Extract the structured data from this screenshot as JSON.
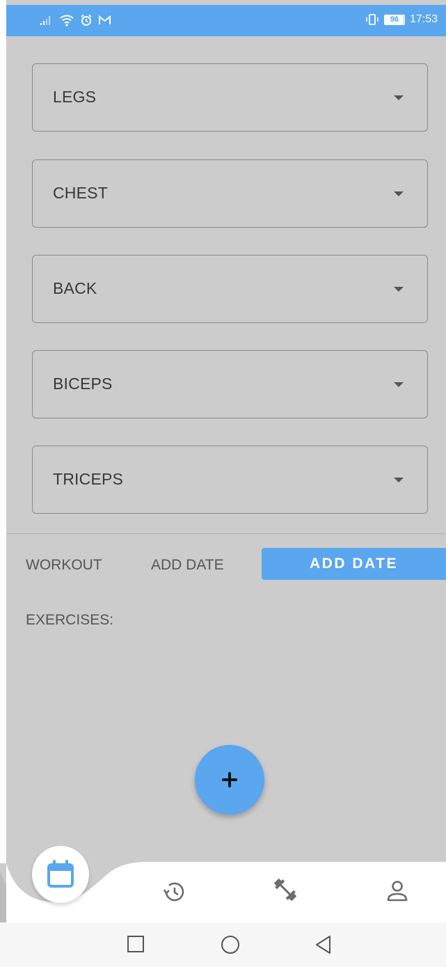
{
  "status_bar": {
    "time": "17:53",
    "battery_level": "96",
    "icons": [
      "signal-icon",
      "wifi-icon",
      "alarm-icon",
      "gmail-icon",
      "vibrate-icon",
      "battery-icon"
    ]
  },
  "muscle_groups": [
    {
      "label": "LEGS"
    },
    {
      "label": "CHEST"
    },
    {
      "label": "BACK"
    },
    {
      "label": "BICEPS"
    },
    {
      "label": "TRICEPS"
    }
  ],
  "workout_row": {
    "workout_label": "WORKOUT",
    "date_value": "ADD DATE",
    "add_date_button": "ADD DATE"
  },
  "exercises_label": "EXERCISES:",
  "fab": {
    "icon": "plus-icon"
  },
  "bottom_nav": {
    "items": [
      {
        "icon": "calendar-icon",
        "active": true
      },
      {
        "icon": "history-icon",
        "active": false
      },
      {
        "icon": "dumbbell-icon",
        "active": false
      },
      {
        "icon": "profile-icon",
        "active": false
      }
    ]
  },
  "system_nav": {
    "icons": [
      "recents-icon",
      "home-icon",
      "back-icon"
    ]
  },
  "colors": {
    "accent": "#5aa6ef",
    "background": "#cccccc",
    "text": "#383838",
    "icon": "#6b6b6b"
  }
}
